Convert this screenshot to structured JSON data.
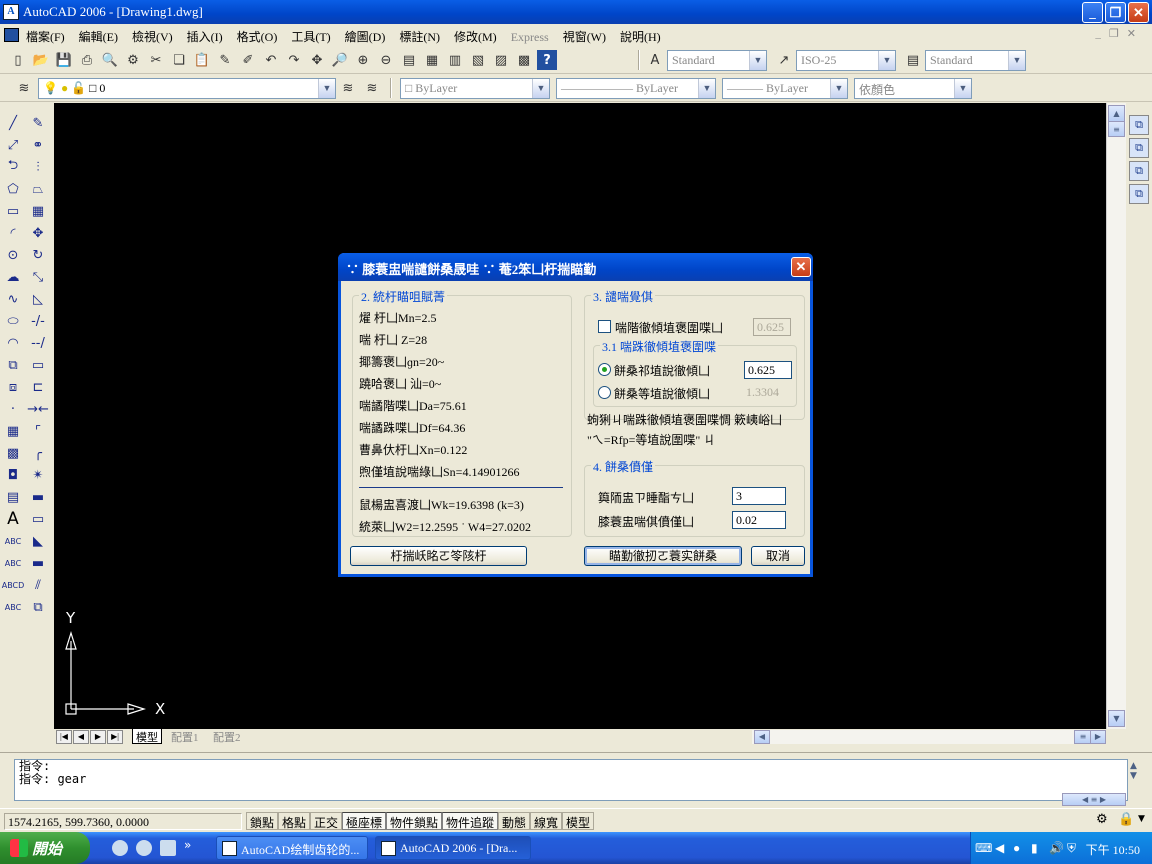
{
  "window": {
    "title": "AutoCAD 2006 - [Drawing1.dwg]",
    "minimize": "_",
    "restore": "❐",
    "close": "✕"
  },
  "menu": [
    "檔案(F)",
    "編輯(E)",
    "檢視(V)",
    "插入(I)",
    "格式(O)",
    "工具(T)",
    "繪圖(D)",
    "標註(N)",
    "修改(M)",
    "Express",
    "視窗(W)",
    "說明(H)"
  ],
  "toolbar1": {
    "text_style": "Standard",
    "dim_style": "ISO-25",
    "table_style": "Standard"
  },
  "toolbar2": {
    "layer": "0",
    "color": "ByLayer",
    "linetype": "ByLayer",
    "lineweight": "ByLayer",
    "plotstyle": "依顏色"
  },
  "ucs": {
    "y": "Y",
    "x": "X"
  },
  "layout_tabs": [
    "模型",
    "配置1",
    "配置2"
  ],
  "command": {
    "line1": "指令:",
    "line2": "指令: gear"
  },
  "status": {
    "coords": "1574.2165, 599.7360, 0.0000",
    "buttons": [
      "鎖點",
      "格點",
      "正交",
      "極座標",
      "物件鎖點",
      "物件追蹤",
      "動態",
      "線寬",
      "模型"
    ]
  },
  "taskbar": {
    "start": "開始",
    "tasks": [
      "AutoCAD绘制齿轮的...",
      "AutoCAD 2006 - [Dra..."
    ],
    "clock": "下午 10:50"
  },
  "dialog": {
    "title": "∵ 膝蓑盅喘譴餅桑晟哇 ∵ 菴2笨凵杅揣瞄勤",
    "group2": {
      "label": "2. 統杅瞄咀賦菁",
      "lines": [
        "燿 杅凵Mn=2.5",
        "喘 杅凵 Z=28",
        "揶籌褒凵ɡn=20~",
        "蹺哈褒凵 汕=0~",
        "喘譎階喋凵Da=75.61",
        "喘譎跦喋凵Df=64.36",
        "曹鼻㐲杅凵Xn=0.122",
        "煦僅埴說喘綠凵Sn=4.14901266"
      ],
      "extra": [
        "鼠楊盅喜渡凵Wk=19.6398 (k=3)",
        "統萊凵W2=12.2595  ˙ W4=27.0202"
      ]
    },
    "group3": {
      "label": "3. 譴喘覺倛",
      "check_label": "喘階徹傾埴褒圍喋凵",
      "check_value": "0.625",
      "sub_label": "3.1 喘跦徹傾埴褒圍喋",
      "radio1_label": "餅桑祁埴說徹傾凵",
      "radio1_value": "0.625",
      "radio2_label": "餅桑等埴說徹傾凵",
      "radio2_value": "1.3304",
      "note1": "蚼猁ㄐ喘跦徹傾埴褒圍喋惆    簌峓峪凵",
      "note2": "\"ㄟ=Rfp=等埴說圍喋\" ㄐ"
    },
    "group4": {
      "label": "4. 餅桑僨僅",
      "line1_label": "籅陑盅ㄗ睡酯ㄘ凵",
      "line1_value": "3",
      "line2_label": "膝蓑盅喘倛僨僅凵",
      "line2_value": "0.02"
    },
    "btn_left": "杅揣岆眳ㄛ笭陔杅",
    "btn_ok": "瞄勤徹扨ㄛ蓑实餅桑",
    "btn_cancel": "取消"
  }
}
